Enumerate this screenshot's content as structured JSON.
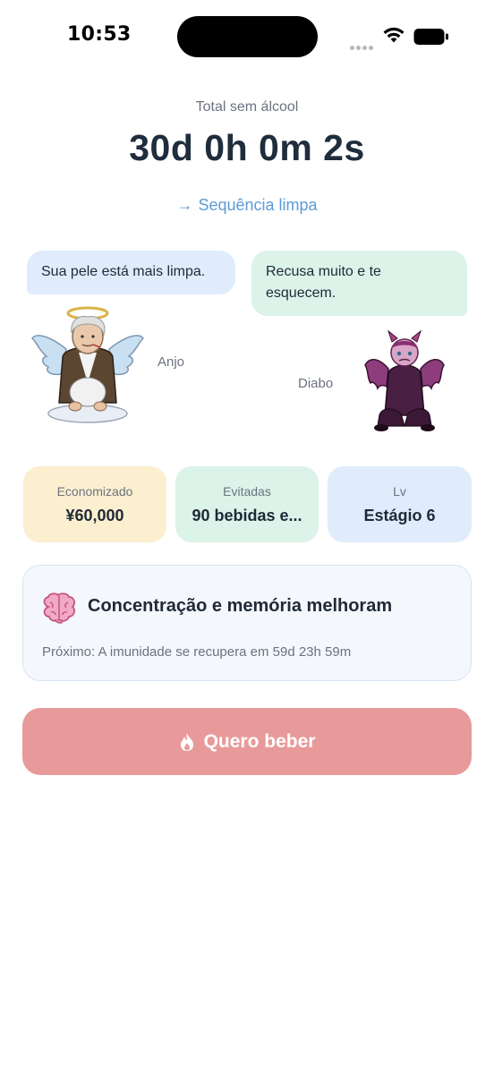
{
  "status_bar": {
    "time": "10:53",
    "icons": [
      "signal-dots-icon",
      "wifi-icon",
      "battery-icon"
    ]
  },
  "header": {
    "label": "Total sem álcool",
    "elapsed": "30d 0h 0m 2s",
    "link_label": "Sequência limpa",
    "link_icon": "arrow-right-icon"
  },
  "characters": {
    "angel": {
      "name": "Anjo",
      "message": "Sua pele está mais limpa."
    },
    "devil": {
      "name": "Diabo",
      "message": "Recusa muito e te esquecem."
    }
  },
  "stats": [
    {
      "label": "Economizado",
      "value": "¥60,000",
      "color": "#fcefcf"
    },
    {
      "label": "Evitadas",
      "value": "90 bebidas e...",
      "color": "#dcf3e9"
    },
    {
      "label": "Lv",
      "value": "Estágio 6",
      "color": "#e0ecfb"
    }
  ],
  "milestone": {
    "icon": "brain-icon",
    "title": "Concentração e memória melhoram",
    "next": "Próximo: A imunidade se recupera em 59d 23h 59m"
  },
  "action_button": {
    "label": "Quero beber",
    "icon": "fire-icon",
    "color": "#e89a9a"
  },
  "colors": {
    "accent_link": "#5b9bd5",
    "text_primary": "#1f2d3d",
    "text_muted": "#6b7280"
  }
}
